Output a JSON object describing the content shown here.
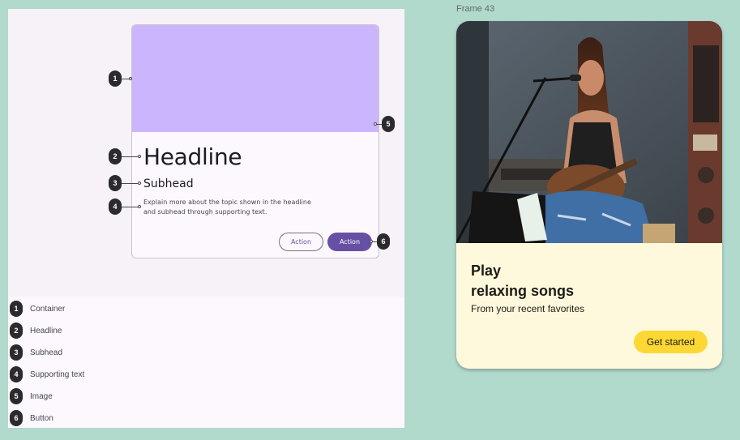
{
  "spec": {
    "card": {
      "headline": "Headline",
      "subhead": "Subhead",
      "supporting_text": "Explain more about the topic shown in the headline and subhead through supporting text.",
      "outline_button_label": "Action",
      "filled_button_label": "Action"
    },
    "callouts": [
      "1",
      "2",
      "3",
      "4",
      "5",
      "6"
    ],
    "legend": [
      {
        "number": "1",
        "label": "Container"
      },
      {
        "number": "2",
        "label": "Headline"
      },
      {
        "number": "3",
        "label": "Subhead"
      },
      {
        "number": "4",
        "label": "Supporting text"
      },
      {
        "number": "5",
        "label": "Image"
      },
      {
        "number": "6",
        "label": "Button"
      }
    ],
    "colors": {
      "media": "#cbb6fd",
      "primary": "#6750a4"
    }
  },
  "frame": {
    "label": "Frame 43",
    "card": {
      "title": "Play relaxing songs",
      "title_line1": "Play",
      "title_line2": "relaxing songs",
      "subtitle": "From your recent favorites",
      "cta_label": "Get started"
    },
    "colors": {
      "card_bg": "#fef9dc",
      "cta": "#fdd835"
    }
  }
}
